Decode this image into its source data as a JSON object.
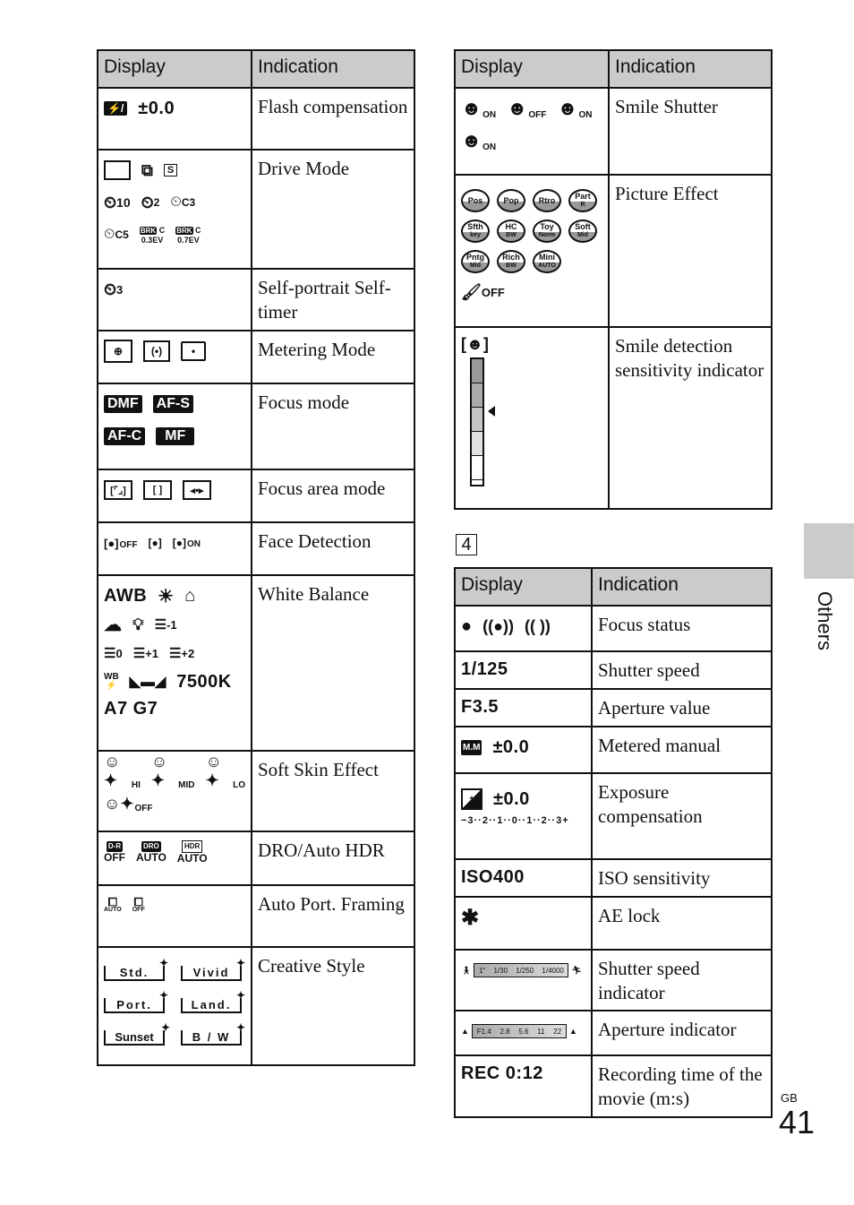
{
  "headers": {
    "display": "Display",
    "indication": "Indication"
  },
  "left_table": [
    {
      "indication": "Flash compensation",
      "display": [
        "flash-comp-icon",
        "±0.0"
      ]
    },
    {
      "indication": "Drive Mode",
      "display": [
        "single-shooting",
        "continuous-shooting",
        "speed-priority-continuous",
        "self-timer-10",
        "self-timer-2",
        "self-timer-C3",
        "self-timer-C5",
        "bracket-C 0.3EV",
        "bracket-C 0.7EV"
      ]
    },
    {
      "indication": "Self-portrait Self-timer",
      "display": [
        "self-timer-3"
      ]
    },
    {
      "indication": "Metering Mode",
      "display": [
        "multi",
        "center",
        "spot"
      ]
    },
    {
      "indication": "Focus mode",
      "display": [
        "DMF",
        "AF-S",
        "AF-C",
        "MF"
      ]
    },
    {
      "indication": "Focus area mode",
      "display": [
        "wide",
        "zone",
        "flexible-spot"
      ]
    },
    {
      "indication": "Face Detection",
      "display": [
        "OFF",
        "registered-faces",
        "ON"
      ]
    },
    {
      "indication": "White Balance",
      "display": [
        "AWB",
        "daylight",
        "shade",
        "cloudy",
        "incandescent",
        "fluor-1",
        "fluor-0",
        "fluor+1",
        "fluor+2",
        "flash-WB",
        "custom",
        "7500K",
        "A7 G7"
      ]
    },
    {
      "indication": "Soft Skin Effect",
      "display": [
        "HI",
        "MID",
        "LO",
        "OFF"
      ]
    },
    {
      "indication": "DRO/Auto HDR",
      "display": [
        "D-R OFF",
        "DRO AUTO",
        "HDR AUTO"
      ]
    },
    {
      "indication": "Auto Port. Framing",
      "display": [
        "AUTO",
        "OFF"
      ]
    },
    {
      "indication": "Creative Style",
      "display": [
        "Std.",
        "Vivid",
        "Port.",
        "Land.",
        "Sunset",
        "B/W"
      ]
    }
  ],
  "left_text": {
    "flash_value": "±0.0",
    "drive": {
      "t10": "10",
      "t2": "2",
      "c3": "C3",
      "c5": "C5",
      "brk": "BRK",
      "c": "C",
      "ev03": "0.3EV",
      "ev07": "0.7EV",
      "s": "S"
    },
    "selftimer3": "3",
    "focus_modes": [
      "DMF",
      "AF-S",
      "AF-C",
      "MF"
    ],
    "face": [
      "OFF",
      "ON"
    ],
    "wb": {
      "awb": "AWB",
      "m1": "-1",
      "z": "0",
      "p1": "+1",
      "p2": "+2",
      "wb": "WB",
      "k": "7500K",
      "ag": "A7 G7"
    },
    "skin": [
      "HI",
      "MID",
      "LO",
      "OFF"
    ],
    "dro": [
      {
        "top": "D-R",
        "bot": "OFF"
      },
      {
        "top": "DRO",
        "bot": "AUTO"
      },
      {
        "top": "HDR",
        "bot": "AUTO"
      }
    ],
    "apf": [
      "AUTO",
      "OFF"
    ],
    "styles": [
      "Std.",
      "Vivid",
      "Port.",
      "Land.",
      "Sunset",
      "B / W"
    ]
  },
  "right_table": [
    {
      "indication": "Smile Shutter"
    },
    {
      "indication": "Picture Effect"
    },
    {
      "indication": "Smile detection sensitivity indicator"
    }
  ],
  "right_text": {
    "smile": [
      "ON",
      "OFF",
      "ON",
      "ON"
    ],
    "effects": [
      {
        "a": "Pos",
        "b": ""
      },
      {
        "a": "Pop",
        "b": ""
      },
      {
        "a": "Rtro",
        "b": ""
      },
      {
        "a": "Part",
        "b": "R"
      },
      {
        "a": "Sfth",
        "b": "key"
      },
      {
        "a": "HC",
        "b": "BW"
      },
      {
        "a": "Toy",
        "b": "Norm"
      },
      {
        "a": "Soft",
        "b": "Mid"
      },
      {
        "a": "Pntg",
        "b": "Mid"
      },
      {
        "a": "Rich",
        "b": "BW"
      },
      {
        "a": "Mini",
        "b": "AUTO"
      }
    ],
    "effect_off": "OFF",
    "smile_sensitivity_level": 3,
    "smile_sensitivity_max": 5
  },
  "section_number": "4",
  "bottom_table": [
    {
      "display": "",
      "indication": "Focus status"
    },
    {
      "display": "1/125",
      "indication": "Shutter speed"
    },
    {
      "display": "F3.5",
      "indication": "Aperture value"
    },
    {
      "display": "±0.0",
      "indication": "Metered manual",
      "icon": "M.M"
    },
    {
      "display": "±0.0",
      "indication": "Exposure compensation",
      "scale": "−3··2··1··0··1··2··3+"
    },
    {
      "display": "ISO400",
      "indication": "ISO sensitivity"
    },
    {
      "display": "✱",
      "indication": "AE lock"
    },
    {
      "display": "",
      "indication": "Shutter speed indicator",
      "ticks": [
        "1\"",
        "1/30",
        "1/250",
        "1/4000"
      ]
    },
    {
      "display": "",
      "indication": "Aperture indicator",
      "ticks": [
        "F1.4",
        "2.8",
        "5.6",
        "11",
        "22"
      ]
    },
    {
      "display": "REC 0:12",
      "indication": "Recording time of the movie (m:s)"
    }
  ],
  "side_tab": "Others",
  "page": {
    "region": "GB",
    "number": "41"
  }
}
